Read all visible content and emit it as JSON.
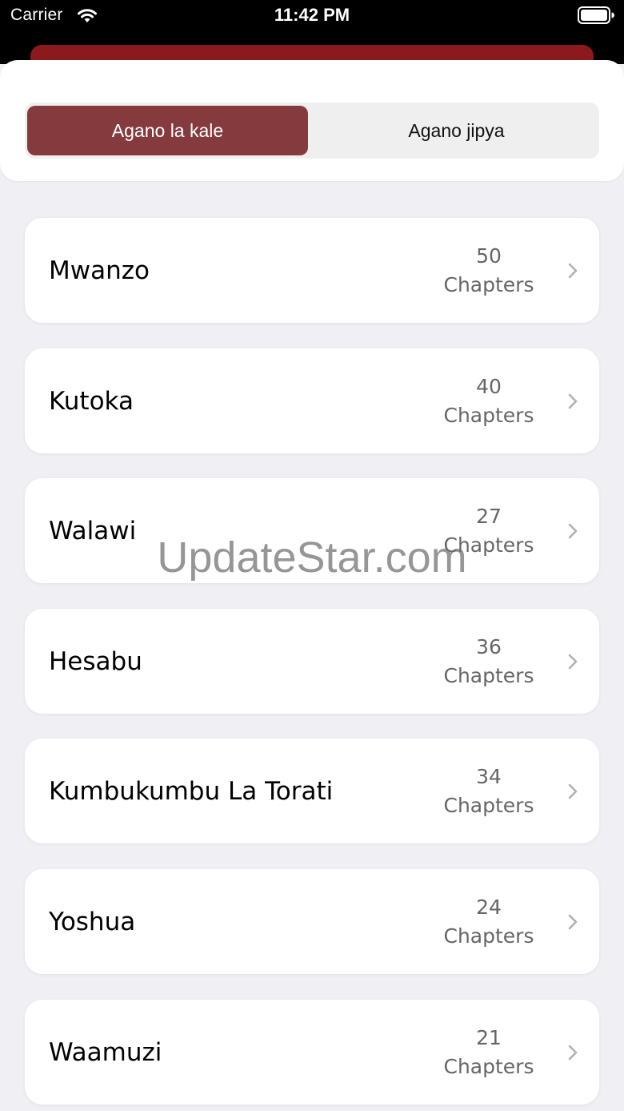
{
  "status_bar": {
    "carrier": "Carrier",
    "time": "11:42 PM",
    "wifi_icon": "wifi-icon",
    "battery_icon": "battery-icon"
  },
  "colors": {
    "accent": "#853a3e",
    "header": "#8b1a1f",
    "background": "#efeff4"
  },
  "segmented_control": {
    "segments": [
      {
        "label": "Agano la kale",
        "selected": true
      },
      {
        "label": "Agano jipya",
        "selected": false
      }
    ]
  },
  "books": [
    {
      "name": "Mwanzo",
      "count": "50",
      "unit": "Chapters"
    },
    {
      "name": "Kutoka",
      "count": "40",
      "unit": "Chapters"
    },
    {
      "name": "Walawi",
      "count": "27",
      "unit": "Chapters"
    },
    {
      "name": "Hesabu",
      "count": "36",
      "unit": "Chapters"
    },
    {
      "name": "Kumbukumbu La Torati",
      "count": "34",
      "unit": "Chapters"
    },
    {
      "name": "Yoshua",
      "count": "24",
      "unit": "Chapters"
    },
    {
      "name": "Waamuzi",
      "count": "21",
      "unit": "Chapters"
    }
  ],
  "watermark": "UpdateStar.com"
}
